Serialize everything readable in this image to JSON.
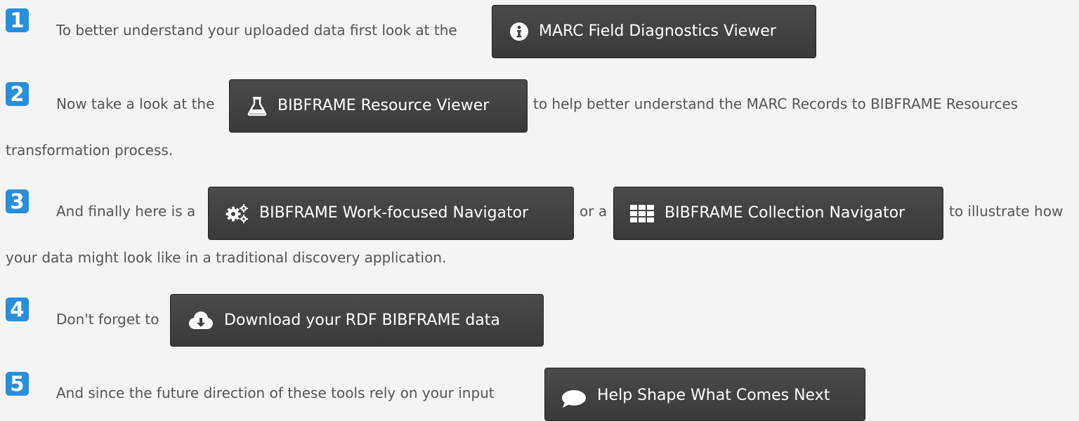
{
  "steps": [
    {
      "number": "1",
      "text_before": "To better understand your uploaded data first look at the",
      "button": {
        "label": "MARC Field Diagnostics Viewer",
        "icon": "info-circle-icon"
      }
    },
    {
      "number": "2",
      "text_before": "Now take a look at the",
      "button": {
        "label": "BIBFRAME Resource Viewer",
        "icon": "flask-icon"
      },
      "text_after": "to help better understand the MARC Records to BIBFRAME Resources",
      "text_continued": "transformation process."
    },
    {
      "number": "3",
      "text_before": "And finally here is a",
      "button": {
        "label": "BIBFRAME Work-focused Navigator",
        "icon": "gears-icon"
      },
      "text_middle": "or a",
      "button2": {
        "label": "BIBFRAME Collection Navigator",
        "icon": "grid-icon"
      },
      "text_after": "to illustrate how",
      "text_continued": "your data might look like in a traditional discovery application."
    },
    {
      "number": "4",
      "text_before": "Don't forget to",
      "button": {
        "label": "Download your RDF BIBFRAME data",
        "icon": "cloud-download-icon"
      }
    },
    {
      "number": "5",
      "text_before": "And since the future direction of these tools rely on your input",
      "button": {
        "label": "Help Shape What Comes Next",
        "icon": "comment-icon"
      }
    }
  ],
  "colors": {
    "badge": "#2a8fdb",
    "button_bg": "#424242",
    "text": "#555555",
    "background": "#f4f4f4"
  }
}
